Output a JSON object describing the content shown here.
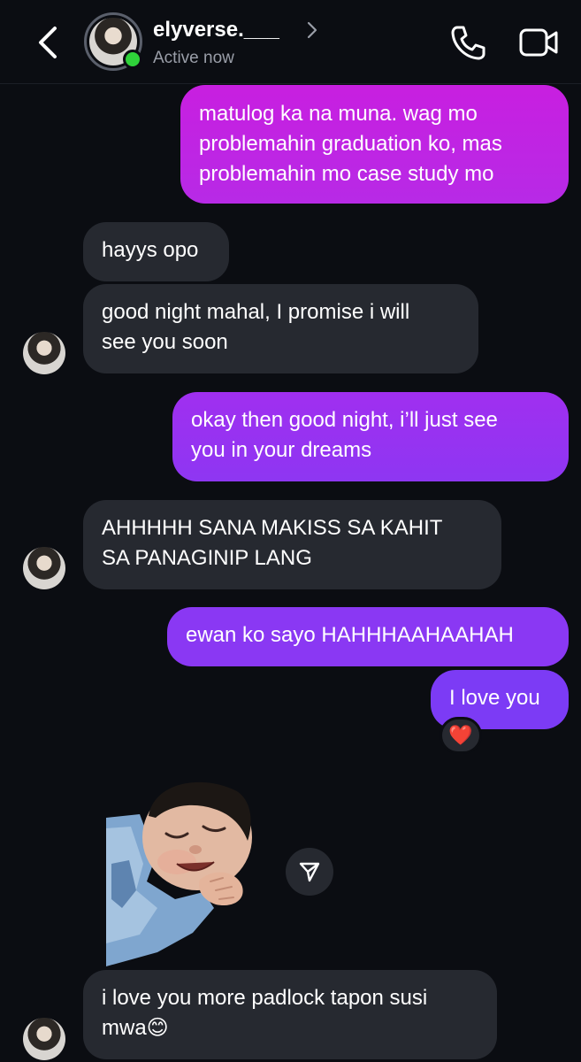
{
  "header": {
    "username": "elyverse.___",
    "status": "Active now",
    "icons": [
      "back-arrow-icon",
      "chevron-right-icon",
      "phone-icon",
      "video-camera-icon"
    ]
  },
  "messages": [
    {
      "from": "me",
      "text": "matulog ka na muna. wag mo\nproblemahin graduation ko, mas\nproblemahin mo case study mo"
    },
    {
      "from": "them",
      "text": "hayys opo"
    },
    {
      "from": "them",
      "text": "good night mahal, I promise i will\nsee you soon"
    },
    {
      "from": "me",
      "text": "okay then good night, i’ll just see\nyou in your dreams"
    },
    {
      "from": "them",
      "text": "AHHHHH SANA MAKISS SA KAHIT\nSA PANAGINIP LANG"
    },
    {
      "from": "me",
      "text": "ewan ko sayo HAHHHAAHAAHAH"
    },
    {
      "from": "me",
      "text": "I love you",
      "reaction": "❤️"
    },
    {
      "from": "them",
      "type": "sticker",
      "sticker": "smiling-baby-sticker"
    },
    {
      "from": "them",
      "text": "i love you more padlock tapon susi\nmwa😊"
    }
  ],
  "colors": {
    "background": "#0b0d12",
    "received_bubble": "#262930",
    "sent_gradient_top": "#c81fe0",
    "sent_gradient_bottom": "#7c3bf5",
    "online": "#2fd23a"
  }
}
